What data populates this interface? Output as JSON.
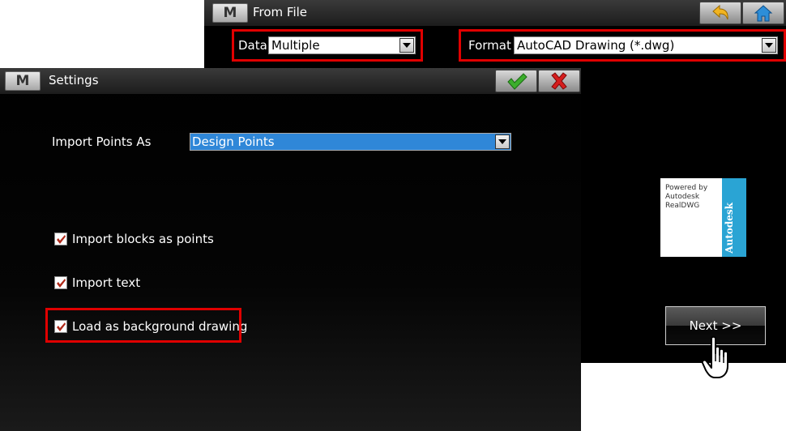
{
  "back_window": {
    "title": "From File",
    "menu_button": "M",
    "data_label": "Data",
    "data_value": "Multiple",
    "format_label": "Format",
    "format_value": "AutoCAD Drawing (*.dwg)",
    "badge": {
      "line1": "Powered by",
      "line2": "Autodesk",
      "line3": "RealDWG",
      "brand": "Autodesk"
    },
    "next_button": "Next >>"
  },
  "settings_window": {
    "title": "Settings",
    "menu_button": "M",
    "import_points_label": "Import Points As",
    "import_points_value": "Design Points",
    "options": [
      {
        "label": "Import blocks as points",
        "checked": true
      },
      {
        "label": "Import text",
        "checked": true
      },
      {
        "label": "Load as background drawing",
        "checked": true
      }
    ]
  },
  "colors": {
    "highlight": "#e00000",
    "selection": "#2f87d8",
    "autodesk_blue": "#2aa4d4",
    "accept_green": "#3cae2c",
    "cancel_red": "#d61d1d"
  },
  "icons": [
    "back-arrow-icon",
    "home-icon",
    "accept-check-icon",
    "cancel-x-icon",
    "hand-cursor-icon"
  ]
}
